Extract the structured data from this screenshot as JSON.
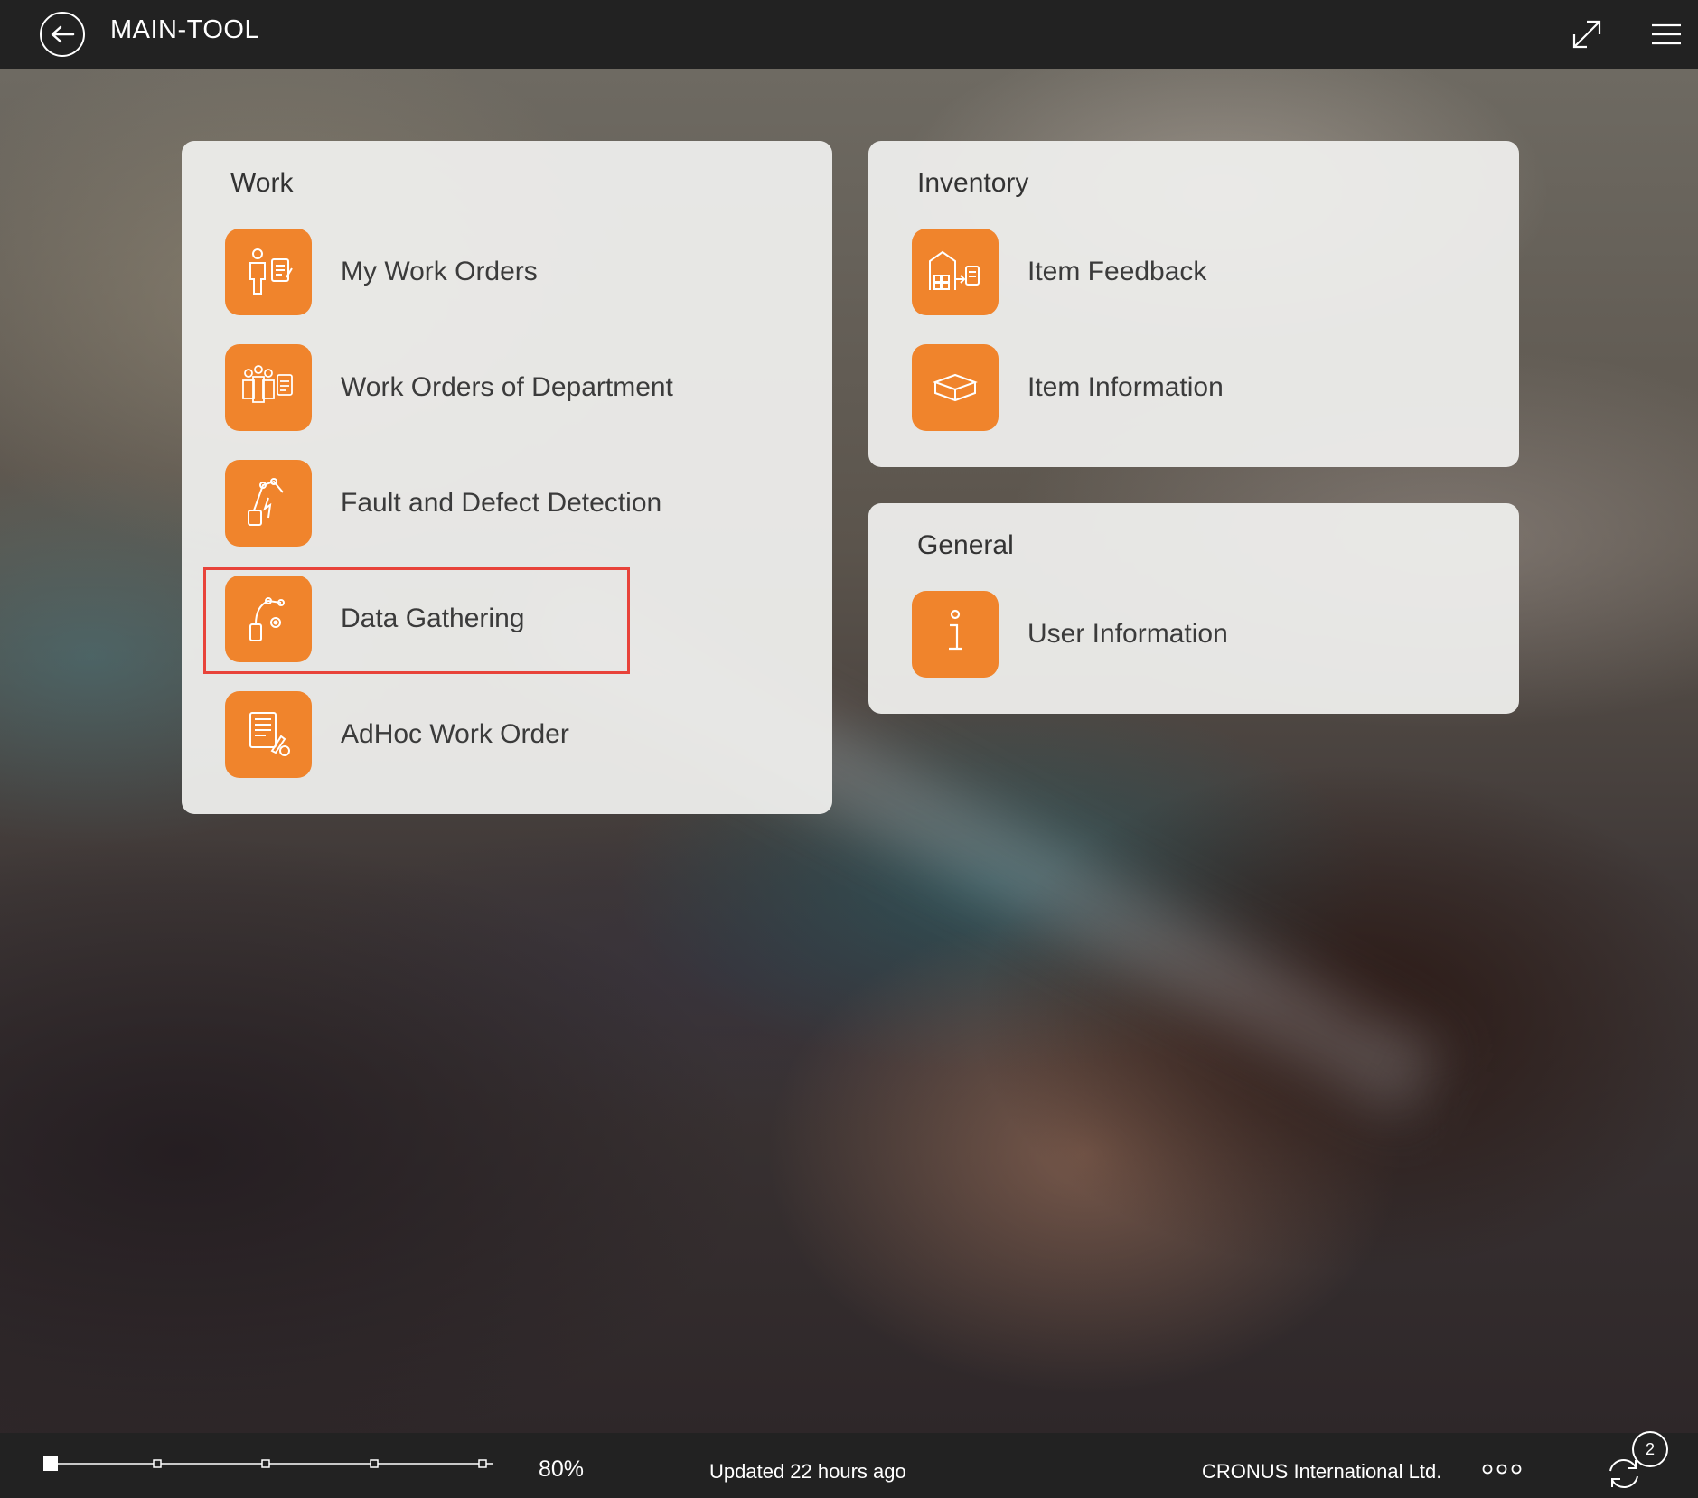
{
  "header": {
    "title": "MAIN-TOOL",
    "back_icon": "arrow-left-circle-icon",
    "expand_icon": "expand-icon",
    "menu_icon": "hamburger-menu-icon"
  },
  "cards": {
    "work": {
      "title": "Work",
      "items": [
        {
          "label": "My Work Orders",
          "icon": "worker-document-icon"
        },
        {
          "label": "Work Orders of Department",
          "icon": "team-document-icon"
        },
        {
          "label": "Fault and Defect Detection",
          "icon": "robot-arm-fault-icon"
        },
        {
          "label": "Data Gathering",
          "icon": "robot-arm-data-icon",
          "highlighted": true
        },
        {
          "label": "AdHoc Work Order",
          "icon": "document-edit-icon"
        }
      ]
    },
    "inventory": {
      "title": "Inventory",
      "items": [
        {
          "label": "Item Feedback",
          "icon": "warehouse-feedback-icon"
        },
        {
          "label": "Item Information",
          "icon": "box-icon"
        }
      ]
    },
    "general": {
      "title": "General",
      "items": [
        {
          "label": "User Information",
          "icon": "info-icon"
        }
      ]
    }
  },
  "footer": {
    "zoom": "80%",
    "zoom_level": 0,
    "updated": "Updated 22 hours ago",
    "company": "CRONUS International Ltd.",
    "more_icon": "more-dots-icon",
    "sync_icon": "sync-icon",
    "sync_badge": "2"
  },
  "colors": {
    "accent": "#f0842c",
    "bar": "#222222",
    "highlight": "#e8433a"
  }
}
